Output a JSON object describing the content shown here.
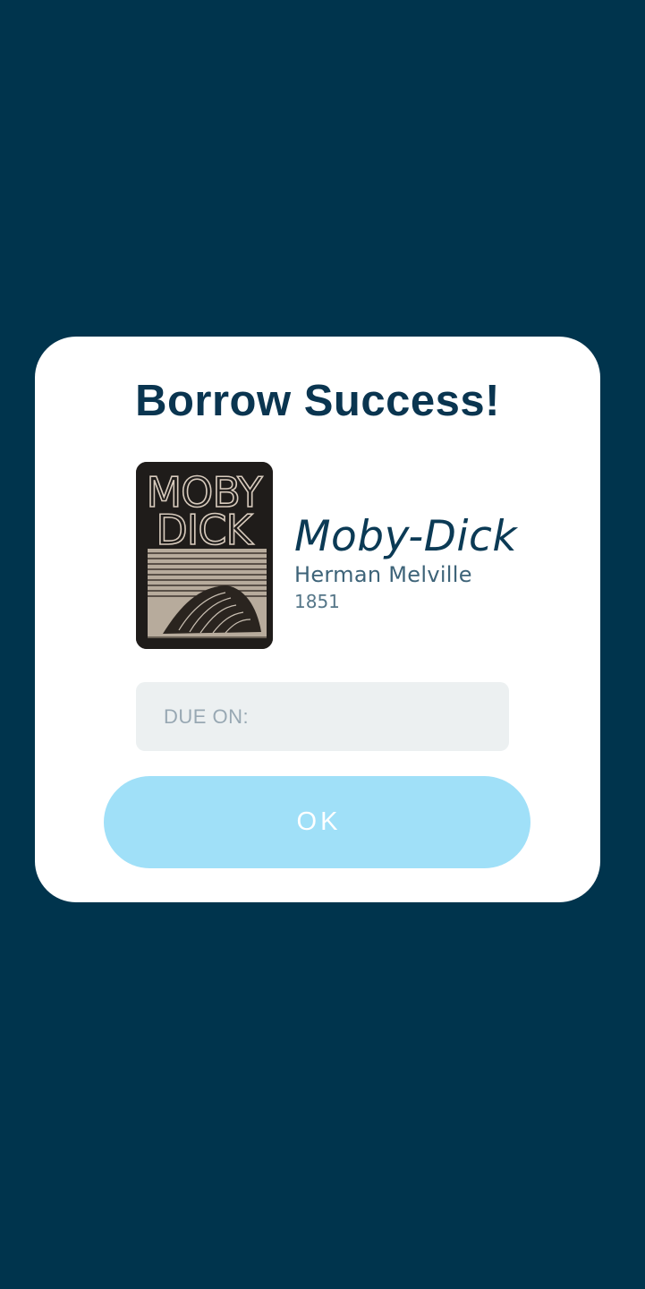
{
  "dialog": {
    "title": "Borrow Success!",
    "book": {
      "title": "Moby-Dick",
      "author": "Herman Melville",
      "year": "1851",
      "cover_text_line1": "MOBY",
      "cover_text_line2": "DICK"
    },
    "due": {
      "label": "DUE ON:",
      "value": ""
    },
    "ok_label": "OK"
  },
  "colors": {
    "background": "#00344d",
    "dialog": "#ffffff",
    "title": "#0a3550",
    "due_box": "#ecf0f1",
    "ok_button": "#a0e0f8"
  }
}
